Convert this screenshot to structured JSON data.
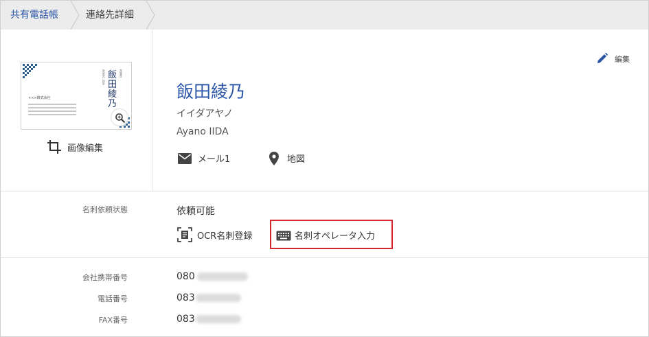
{
  "breadcrumb": {
    "items": [
      "共有電話帳",
      "連絡先詳細"
    ]
  },
  "card": {
    "company": "×××株式会社",
    "name": "飯田綾乃",
    "title": "営業部",
    "romaji": "AYANO IIDA"
  },
  "actions": {
    "image_edit": "画像編集",
    "edit": "編集"
  },
  "contact": {
    "name": "飯田綾乃",
    "kana": "イイダアヤノ",
    "romaji": "Ayano IIDA",
    "mail": "メール1",
    "map": "地図"
  },
  "card_request": {
    "label": "名刺依頼状態",
    "value": "依頼可能",
    "ocr": "OCR名刺登録",
    "operator": "名刺オペレータ入力"
  },
  "phones": {
    "mobile_label": "会社携帯番号",
    "mobile_value": "080",
    "phone_label": "電話番号",
    "phone_value": "083",
    "fax_label": "FAX番号",
    "fax_value": "083"
  },
  "colors": {
    "accent": "#2b56a8",
    "highlight": "#d8262f",
    "breadcrumb_bg": "#ececec"
  }
}
